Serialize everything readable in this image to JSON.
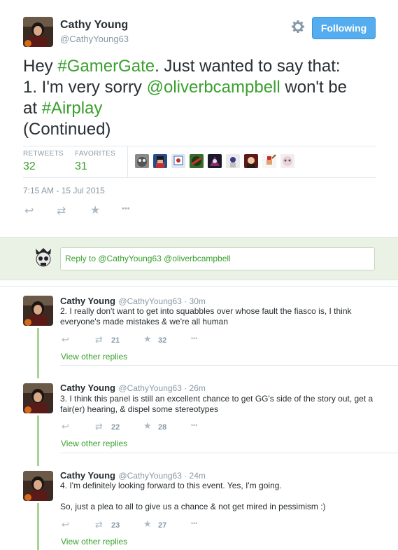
{
  "header": {
    "name": "Cathy Young",
    "handle": "@CathyYoung63",
    "follow_label": "Following"
  },
  "tweet": {
    "parts": {
      "p1": "Hey ",
      "p2": "#GamerGate",
      "p3": ". Just wanted to say that:",
      "p4": "1. I'm very sorry ",
      "p5": "@oliverbcampbell",
      "p6": " won't be",
      "p7": "at ",
      "p8": "#Airplay",
      "p9": "(Continued)"
    },
    "retweets_label": "RETWEETS",
    "retweets": "32",
    "favorites_label": "FAVORITES",
    "favorites": "31",
    "timestamp": "7:15 AM - 15 Jul 2015"
  },
  "reply": {
    "placeholder": "Reply to @CathyYoung63 @oliverbcampbell"
  },
  "conversation": [
    {
      "name": "Cathy Young",
      "meta": "@CathyYoung63 · 30m",
      "text": "2. I really don't want to get into squabbles over whose fault the fiasco is, I think everyone's made mistakes & we're all human",
      "retweets": "21",
      "favorites": "32",
      "view_replies": "View other replies"
    },
    {
      "name": "Cathy Young",
      "meta": "@CathyYoung63 · 26m",
      "text": "3. I think this panel is still an excellent chance to get GG's side of the story out, get a fair(er) hearing, & dispel some stereotypes",
      "retweets": "22",
      "favorites": "28",
      "view_replies": "View other replies"
    },
    {
      "name": "Cathy Young",
      "meta": "@CathyYoung63 · 24m",
      "text": "4. I'm definitely looking forward to this event. Yes, I'm going.",
      "text2": "So, just a plea to all to give us a chance & not get mired in pessimism :)",
      "retweets": "23",
      "favorites": "27",
      "view_replies": "View other replies"
    }
  ],
  "icons": {
    "reply": "↩",
    "retweet": "⇄",
    "favorite": "★",
    "more": "•••",
    "gear": "⚙"
  },
  "colors": {
    "accent": "#3aa02e",
    "follow_button": "#55acee",
    "muted": "#8899a6"
  }
}
